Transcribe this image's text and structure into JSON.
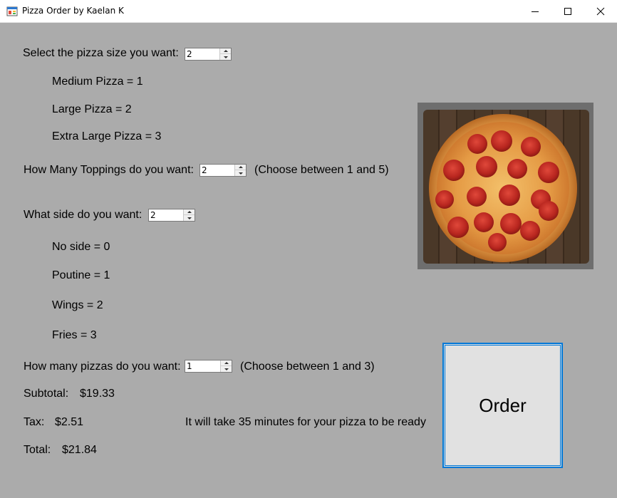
{
  "window": {
    "title": "Pizza Order by Kaelan K"
  },
  "size_section": {
    "prompt": "Select the pizza size you want:",
    "value": "2",
    "options": [
      "Medium Pizza = 1",
      "Large Pizza = 2",
      "Extra Large Pizza = 3"
    ]
  },
  "toppings_section": {
    "prompt": "How Many Toppings do you want:",
    "value": "2",
    "hint": "(Choose between 1 and 5)"
  },
  "side_section": {
    "prompt": "What side do you want:",
    "value": "2",
    "options": [
      "No side = 0",
      "Poutine = 1",
      "Wings = 2",
      "Fries = 3"
    ]
  },
  "quantity_section": {
    "prompt": "How many pizzas do you want:",
    "value": "1",
    "hint": "(Choose between 1 and 3)"
  },
  "totals": {
    "subtotal_label": "Subtotal:",
    "subtotal_value": "$19.33",
    "tax_label": "Tax:",
    "tax_value": "$2.51",
    "total_label": "Total:",
    "total_value": "$21.84",
    "ready_message": "It will take 35 minutes for your pizza to be ready"
  },
  "order_button": {
    "label": "Order"
  },
  "colors": {
    "form_background": "#ababab",
    "button_border": "#0078d7"
  }
}
